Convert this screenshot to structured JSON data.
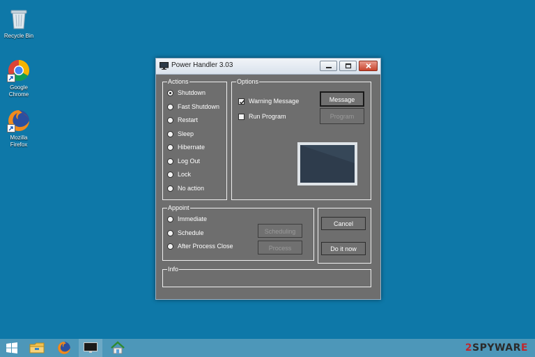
{
  "desktop": {
    "icons": [
      {
        "label": "Recycle Bin",
        "icon": "recycle-bin-icon"
      },
      {
        "label": "Google Chrome",
        "icon": "chrome-icon"
      },
      {
        "label": "Mozilla Firefox",
        "icon": "firefox-icon"
      }
    ],
    "background_color": "#0e78a8"
  },
  "window": {
    "title": "Power Handler 3.03",
    "actions": {
      "label": "Actions",
      "options": [
        "Shutdown",
        "Fast Shutdown",
        "Restart",
        "Sleep",
        "Hibernate",
        "Log Out",
        "Lock",
        "No action"
      ],
      "selected": "Shutdown"
    },
    "options": {
      "label": "Options",
      "warning_message": {
        "label": "Warning Message",
        "checked": true
      },
      "run_program": {
        "label": "Run Program",
        "checked": false
      },
      "message_button": "Message",
      "program_button": "Program"
    },
    "appoint": {
      "label": "Appoint",
      "options": [
        "Immediate",
        "Schedule",
        "After Process Close"
      ],
      "scheduling_button": "Scheduling",
      "process_button": "Process"
    },
    "cancel_button": "Cancel",
    "do_it_now_button": "Do it now",
    "info": {
      "label": "Info"
    }
  },
  "taskbar": {
    "items": [
      "start-button",
      "file-explorer-icon",
      "firefox-icon",
      "power-handler-icon",
      "house-icon"
    ],
    "watermark_prefix": "2",
    "watermark_text": "SPYWAR",
    "watermark_suffix": "E"
  }
}
